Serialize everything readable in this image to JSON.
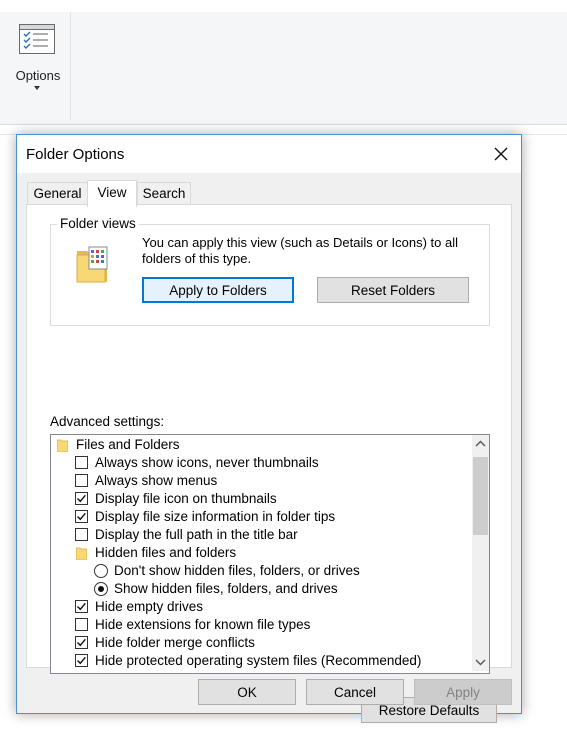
{
  "ribbon": {
    "options_label": "Options",
    "options_icon": "options-checklist-icon"
  },
  "dialog": {
    "title": "Folder Options",
    "close_icon": "close-icon",
    "tabs": [
      {
        "label": "General",
        "active": false
      },
      {
        "label": "View",
        "active": true
      },
      {
        "label": "Search",
        "active": false
      }
    ],
    "folder_views": {
      "legend": "Folder views",
      "description": "You can apply this view (such as Details or Icons) to all folders of this type.",
      "apply_button": "Apply to Folders",
      "reset_button": "Reset Folders"
    },
    "advanced_label": "Advanced settings:",
    "advanced_items": [
      {
        "type": "folder",
        "label": "Files and Folders",
        "level": 0
      },
      {
        "type": "checkbox",
        "label": "Always show icons, never thumbnails",
        "checked": false,
        "level": 1
      },
      {
        "type": "checkbox",
        "label": "Always show menus",
        "checked": false,
        "level": 1
      },
      {
        "type": "checkbox",
        "label": "Display file icon on thumbnails",
        "checked": true,
        "level": 1
      },
      {
        "type": "checkbox",
        "label": "Display file size information in folder tips",
        "checked": true,
        "level": 1
      },
      {
        "type": "checkbox",
        "label": "Display the full path in the title bar",
        "checked": false,
        "level": 1
      },
      {
        "type": "folder",
        "label": "Hidden files and folders",
        "level": 1
      },
      {
        "type": "radio",
        "label": "Don't show hidden files, folders, or drives",
        "checked": false,
        "level": 2
      },
      {
        "type": "radio",
        "label": "Show hidden files, folders, and drives",
        "checked": true,
        "level": 2
      },
      {
        "type": "checkbox",
        "label": "Hide empty drives",
        "checked": true,
        "level": 1
      },
      {
        "type": "checkbox",
        "label": "Hide extensions for known file types",
        "checked": false,
        "level": 1
      },
      {
        "type": "checkbox",
        "label": "Hide folder merge conflicts",
        "checked": true,
        "level": 1
      },
      {
        "type": "checkbox",
        "label": "Hide protected operating system files (Recommended)",
        "checked": true,
        "level": 1
      }
    ],
    "restore_defaults": "Restore Defaults",
    "ok": "OK",
    "cancel": "Cancel",
    "apply": "Apply",
    "apply_enabled": false
  },
  "colors": {
    "accent": "#0078d7",
    "dialog_bg": "#f0f0f0",
    "folder": "#f8d775"
  }
}
